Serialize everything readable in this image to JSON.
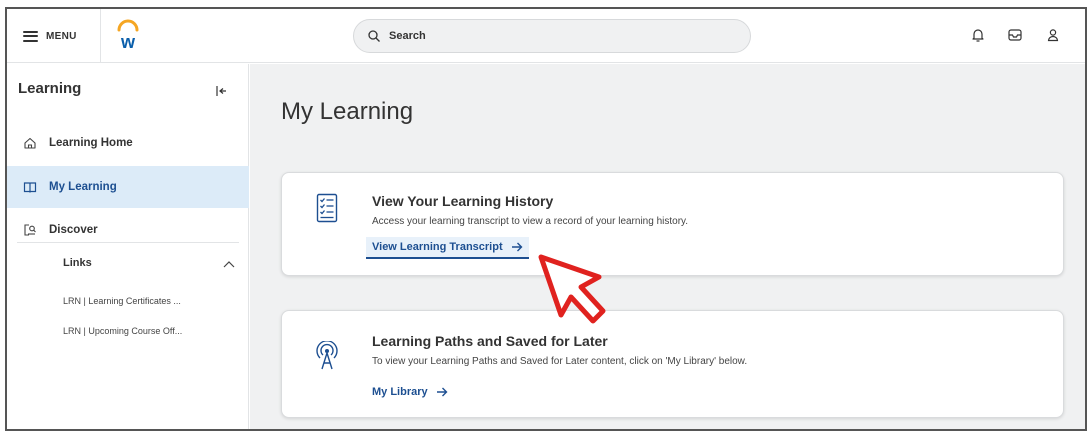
{
  "topbar": {
    "menu_label": "MENU",
    "search_placeholder": "Search",
    "brand_letter": "w"
  },
  "sidebar": {
    "title": "Learning",
    "items": [
      {
        "label": "Learning Home",
        "icon": "home-icon"
      },
      {
        "label": "My Learning",
        "icon": "book-icon",
        "active": true
      },
      {
        "label": "Discover",
        "icon": "discover-icon"
      }
    ],
    "links_header": "Links",
    "links": [
      "LRN | Learning Certificates ...",
      "LRN | Upcoming Course Off..."
    ]
  },
  "main": {
    "title": "My Learning",
    "cards": [
      {
        "title": "View Your Learning History",
        "description": "Access your learning transcript to view a record of your learning history.",
        "link": "View Learning Transcript",
        "icon": "checklist-icon"
      },
      {
        "title": "Learning Paths and Saved for Later",
        "description": "To view your Learning Paths and Saved for Later content, click on 'My Library' below.",
        "link": "My Library",
        "icon": "broadcast-icon"
      }
    ]
  },
  "colors": {
    "accent": "#1d4f91",
    "active_bg": "#dcebf8",
    "main_bg": "#f0f1f2",
    "cursor_red": "#e0221f",
    "brand_blue": "#0b5fab",
    "brand_orange": "#f5a623"
  }
}
